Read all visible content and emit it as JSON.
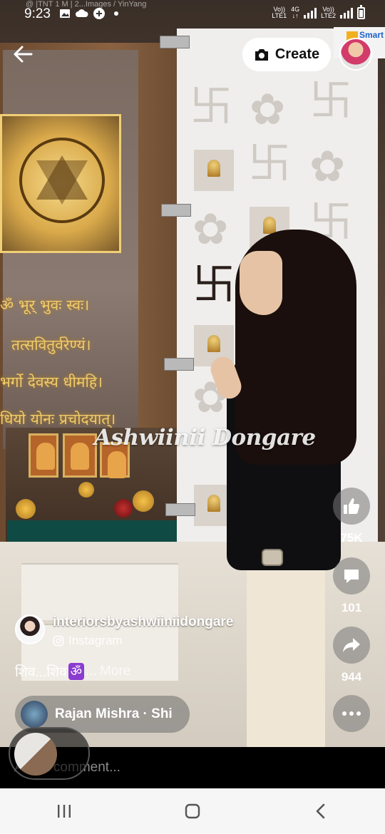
{
  "status_bar": {
    "faint_text": "@ |TNT 1 M | 2...Images / YinYang",
    "time": "9:23",
    "sim1": {
      "label1": "Vo))",
      "label2": "LTE1",
      "tech": "4G"
    },
    "sim2": {
      "label1": "Vo))",
      "label2": "LTE2"
    },
    "icons": [
      "gallery-icon",
      "cloud-icon",
      "settings-icon",
      "dot-icon"
    ]
  },
  "top_bar": {
    "create_label": "Create",
    "ad_text": "Smart"
  },
  "video": {
    "mantra_lines": [
      "ॐ भूर् भुवः स्वः।",
      "तत्सवितुर्वरेण्यं।",
      "भर्गो देवस्य धीमहि।",
      "धियो योनः प्रचोदयात्।"
    ],
    "watermark": "Ashwiinii Dongare"
  },
  "actions": {
    "likes": "75K",
    "comments": "101",
    "shares": "944"
  },
  "post": {
    "author": "interiorsbyashwiiniidongare",
    "source": "Instagram",
    "caption_text": "शिव...शिव",
    "caption_emoji": "ॐ",
    "caption_suffix": "...",
    "more_label": "More"
  },
  "music": {
    "label": "Rajan Mishra · Shi"
  },
  "comment": {
    "placeholder": "Add a comment..."
  },
  "nav": {
    "recents": "recents-icon",
    "home": "home-icon",
    "back": "back-icon"
  },
  "colors": {
    "accent_gold": "#f1cc6a",
    "emoji_purple": "#8a3bd0",
    "teal_shelf": "#0f4a44"
  }
}
